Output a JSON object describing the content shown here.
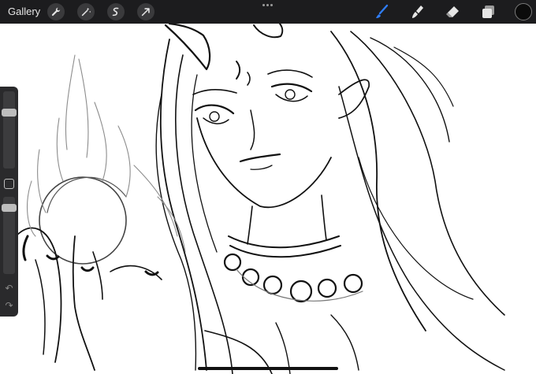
{
  "topbar": {
    "gallery_label": "Gallery",
    "left_tools": [
      {
        "name": "wrench-icon"
      },
      {
        "name": "magic-wand-icon"
      },
      {
        "name": "selection-icon"
      },
      {
        "name": "transform-arrow-icon"
      }
    ],
    "right_tools": [
      {
        "name": "brush-icon",
        "active": true
      },
      {
        "name": "smudge-icon",
        "active": false
      },
      {
        "name": "eraser-icon",
        "active": false
      },
      {
        "name": "layers-icon",
        "active": false
      }
    ],
    "active_color": "#0b0b0b",
    "accent": "#2f7df6"
  },
  "sidebar": {
    "brush_size_level": 0.25,
    "opacity_level": 0.1,
    "undo_icon": "undo-icon",
    "redo_icon": "redo-icon"
  }
}
